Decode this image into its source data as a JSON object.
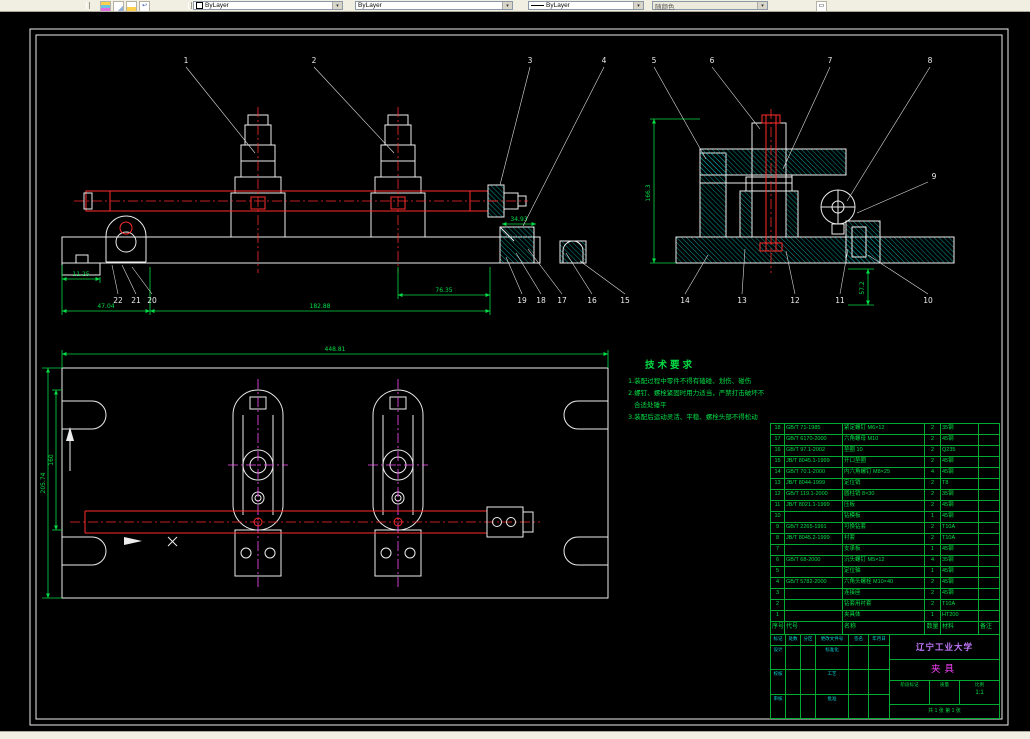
{
  "toolbar": {
    "color_value": "ByLayer",
    "linetype_value": "ByLayer",
    "lineweight_value": "ByLayer",
    "plotstyle_value": "随颜色",
    "dropdown_glyph": "▾"
  },
  "colors": {
    "entity_white": "#ededed",
    "entity_red": "#ff2b2b",
    "entity_green": "#00dd45",
    "entity_teal": "#00a8a8",
    "entity_magenta": "#ff4dff",
    "university_text": "#c478ff",
    "background": "#000000"
  },
  "callouts": {
    "top": [
      "1",
      "2",
      "3",
      "4",
      "5",
      "6",
      "7",
      "8"
    ],
    "side_right": "9",
    "side_bottom": [
      "14",
      "13",
      "12",
      "11",
      "10"
    ],
    "front_bottom": [
      "19",
      "18",
      "17",
      "16",
      "15"
    ],
    "front_left": [
      "22",
      "21",
      "20"
    ]
  },
  "dims": {
    "front_a": "11.25",
    "front_b": "47.04",
    "front_c": "182.88",
    "front_d": "76.35",
    "front_e": "34.93",
    "side_h": "166.3",
    "side_r": "57.2",
    "plan_w": "448.81",
    "plan_h": "205.74",
    "plan_h2": "160"
  },
  "tech_req": {
    "title": "技术要求",
    "lines": [
      "1.装配过程中零件不得有磕碰、划伤、碰伤",
      "2.螺钉、螺栓紧固时用力适当，严禁打击破坏不",
      "合适处锤平",
      "3.装配后运动灵活、平稳、螺栓头部不得松动"
    ]
  },
  "bom": {
    "headers": [
      "序号",
      "代号",
      "名称",
      "数量",
      "材料",
      "备注"
    ],
    "rows": [
      {
        "no": "18",
        "code": "GB/T 71-1985",
        "name": "紧定螺钉 M6×12",
        "qty": "2",
        "mat": "35钢",
        "note": ""
      },
      {
        "no": "17",
        "code": "GB/T 6170-2000",
        "name": "六角螺母 M10",
        "qty": "2",
        "mat": "45钢",
        "note": ""
      },
      {
        "no": "16",
        "code": "GB/T 97.1-2002",
        "name": "垫圈 10",
        "qty": "2",
        "mat": "Q235",
        "note": ""
      },
      {
        "no": "15",
        "code": "JB/T 8045.1-1999",
        "name": "开口垫圈",
        "qty": "2",
        "mat": "45钢",
        "note": ""
      },
      {
        "no": "14",
        "code": "GB/T 70.1-2000",
        "name": "内六角螺钉 M8×25",
        "qty": "4",
        "mat": "45钢",
        "note": ""
      },
      {
        "no": "13",
        "code": "JB/T 8044-1999",
        "name": "定位销",
        "qty": "2",
        "mat": "T8",
        "note": ""
      },
      {
        "no": "12",
        "code": "GB/T 119.1-2000",
        "name": "圆柱销 8×30",
        "qty": "2",
        "mat": "35钢",
        "note": ""
      },
      {
        "no": "11",
        "code": "JB/T 8021.1-1999",
        "name": "压板",
        "qty": "2",
        "mat": "45钢",
        "note": ""
      },
      {
        "no": "10",
        "code": "",
        "name": "钻模板",
        "qty": "1",
        "mat": "45钢",
        "note": ""
      },
      {
        "no": "9",
        "code": "GB/T 2265-1991",
        "name": "可换钻套",
        "qty": "2",
        "mat": "T10A",
        "note": ""
      },
      {
        "no": "8",
        "code": "JB/T 8045.2-1999",
        "name": "衬套",
        "qty": "2",
        "mat": "T10A",
        "note": ""
      },
      {
        "no": "7",
        "code": "",
        "name": "支承板",
        "qty": "1",
        "mat": "45钢",
        "note": ""
      },
      {
        "no": "6",
        "code": "GB/T 68-2000",
        "name": "沉头螺钉 M5×12",
        "qty": "4",
        "mat": "35钢",
        "note": ""
      },
      {
        "no": "5",
        "code": "",
        "name": "定位轴",
        "qty": "1",
        "mat": "45钢",
        "note": ""
      },
      {
        "no": "4",
        "code": "GB/T 5782-2000",
        "name": "六角头螺栓 M10×40",
        "qty": "2",
        "mat": "45钢",
        "note": ""
      },
      {
        "no": "3",
        "code": "",
        "name": "连接座",
        "qty": "2",
        "mat": "45钢",
        "note": ""
      },
      {
        "no": "2",
        "code": "",
        "name": "钻套用衬套",
        "qty": "2",
        "mat": "T10A",
        "note": ""
      },
      {
        "no": "1",
        "code": "",
        "name": "夹具体",
        "qty": "1",
        "mat": "HT200",
        "note": ""
      }
    ]
  },
  "title_block": {
    "university": "辽宁工业大学",
    "part_name": "夹具",
    "mark_headers": [
      "标记",
      "处数",
      "分区",
      "更改文件号",
      "签名",
      "年月日"
    ],
    "design": "设计",
    "check": "校核",
    "audit": "审核",
    "standard": "标准化",
    "craft": "工艺",
    "approve": "批准",
    "stage_label": "阶段标记",
    "mass_label": "质量",
    "scale_label": "比例",
    "scale_value": "1:1",
    "sheet_text": "共 1 张  第 1 张"
  }
}
